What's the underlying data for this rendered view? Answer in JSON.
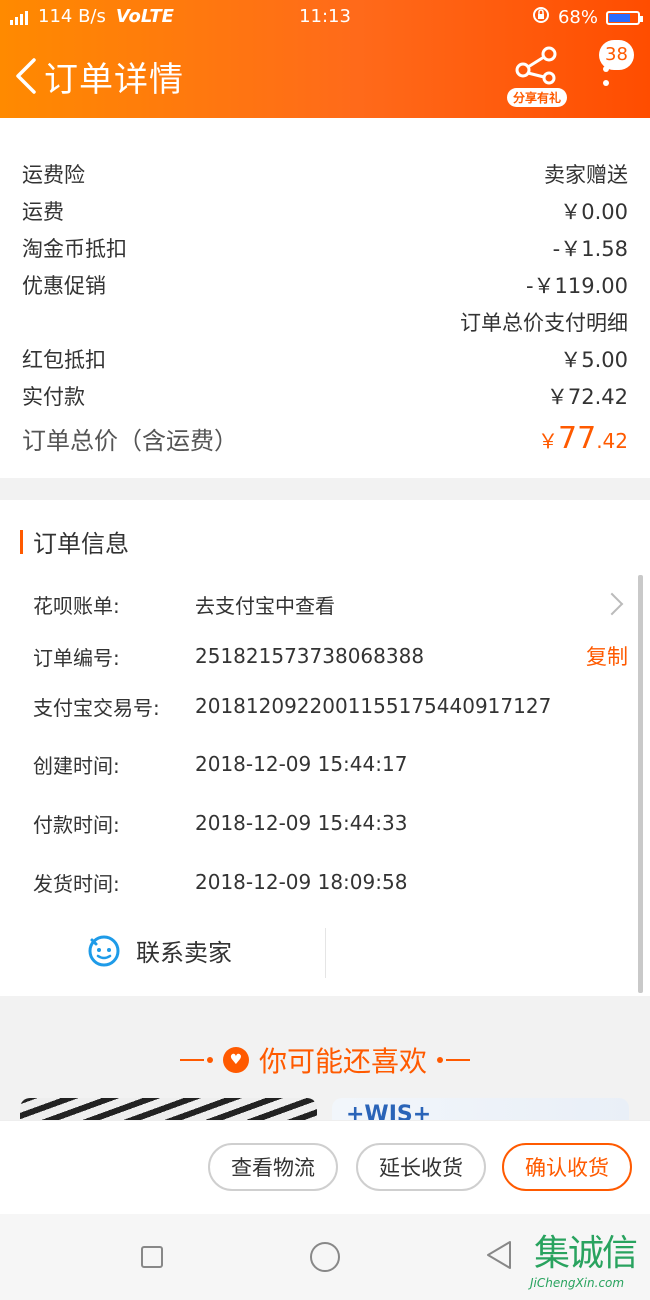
{
  "status_bar": {
    "network": "114 B/s",
    "volte": "VoLTE",
    "time": "11:13",
    "battery": "68%"
  },
  "header": {
    "title": "订单详情",
    "share_label": "分享有礼",
    "message_count": "38",
    "accent": "#ff6a1a"
  },
  "price_rows": [
    {
      "label": "运费险",
      "value": "卖家赠送"
    },
    {
      "label": "运费",
      "value": "￥0.00"
    },
    {
      "label": "淘金币抵扣",
      "value": "-￥1.58"
    },
    {
      "label": "优惠促销",
      "value": "-￥119.00"
    },
    {
      "label": "",
      "value": "订单总价支付明细"
    },
    {
      "label": "红包抵扣",
      "value": "￥5.00"
    },
    {
      "label": "实付款",
      "value": "￥72.42"
    }
  ],
  "order_total": {
    "label": "订单总价（含运费）",
    "currency": "￥",
    "integer": "77",
    "decimal": ".42"
  },
  "order_info": {
    "title": "订单信息",
    "rows": [
      {
        "label": "花呗账单:",
        "value": "去支付宝中查看"
      },
      {
        "label": "订单编号:",
        "value": "251821573738068388",
        "action": "复制"
      },
      {
        "label": "支付宝交易号:",
        "value": "2018120922001155175440917127"
      },
      {
        "label": "创建时间:",
        "value": "2018-12-09 15:44:17"
      },
      {
        "label": "付款时间:",
        "value": "2018-12-09 15:44:33"
      },
      {
        "label": "发货时间:",
        "value": "2018-12-09 18:09:58"
      }
    ],
    "contact_label": "联系卖家"
  },
  "recommend": {
    "title": "你可能还喜欢",
    "right_brand": "+WIS+"
  },
  "actions": {
    "logistics": "查看物流",
    "extend": "延长收货",
    "confirm": "确认收货"
  },
  "watermark": {
    "cn": "集诚信",
    "en": "JiChengXin.com"
  }
}
